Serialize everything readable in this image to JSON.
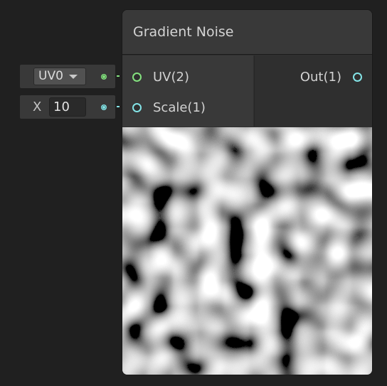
{
  "node": {
    "title": "Gradient Noise",
    "inputs": [
      {
        "label": "UV(2)",
        "color": "#84e27f"
      },
      {
        "label": "Scale(1)",
        "color": "#84e4e7"
      }
    ],
    "outputs": [
      {
        "label": "Out(1)",
        "color": "#84e4e7"
      }
    ]
  },
  "uv_field": {
    "selected": "UV0",
    "icon": "chevron-down-icon"
  },
  "scale_field": {
    "axis": "X",
    "value": "10"
  },
  "colors": {
    "background": "#202020",
    "node_body": "#2f2f2f",
    "node_header": "#393939",
    "vector2_port": "#84e27f",
    "float_port": "#84e4e7"
  }
}
